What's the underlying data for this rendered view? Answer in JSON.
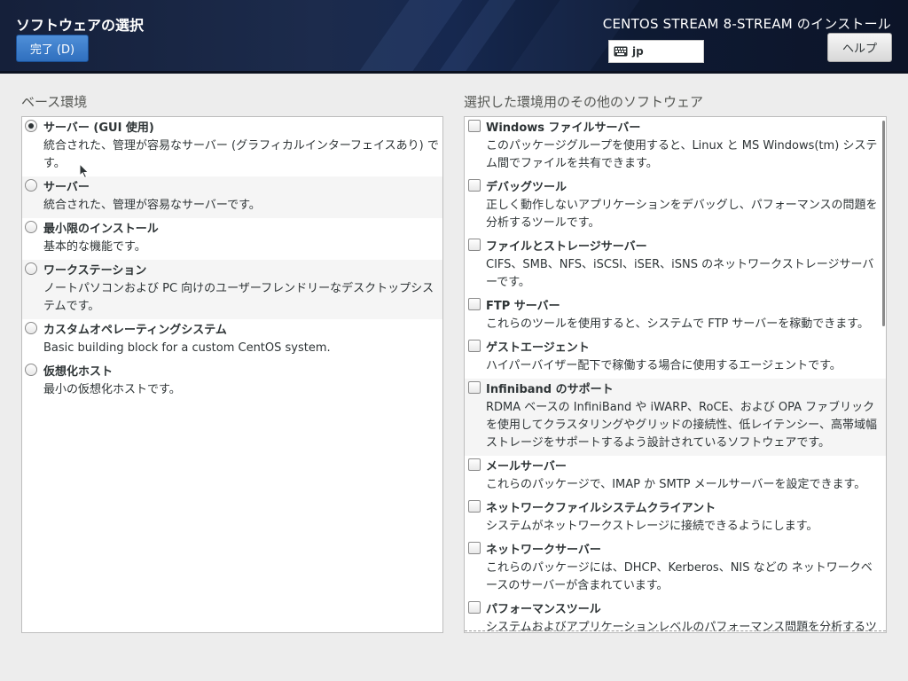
{
  "header": {
    "spoke_title": "ソフトウェアの選択",
    "done_label": "完了 (D)",
    "product_title": "CENTOS STREAM 8-STREAM のインストール",
    "keyboard_layout": "jp",
    "keyboard_icon": "keyboard-icon",
    "help_label": "ヘルプ",
    "accent_color": "#3b7dd0"
  },
  "base_env": {
    "title": "ベース環境",
    "items": [
      {
        "name": "サーバー (GUI 使用)",
        "desc": "統合された、管理が容易なサーバー (グラフィカルインターフェイスあり) です。",
        "selected": true
      },
      {
        "name": "サーバー",
        "desc": "統合された、管理が容易なサーバーです。",
        "selected": false
      },
      {
        "name": "最小限のインストール",
        "desc": "基本的な機能です。",
        "selected": false
      },
      {
        "name": "ワークステーション",
        "desc": "ノートパソコンおよび PC 向けのユーザーフレンドリーなデスクトップシステムです。",
        "selected": false
      },
      {
        "name": "カスタムオペレーティングシステム",
        "desc": "Basic building block for a custom CentOS system.",
        "selected": false
      },
      {
        "name": "仮想化ホスト",
        "desc": "最小の仮想化ホストです。",
        "selected": false
      }
    ]
  },
  "addons": {
    "title": "選択した環境用のその他のソフトウェア",
    "items": [
      {
        "name": "Windows ファイルサーバー",
        "desc": "このパッケージグループを使用すると、Linux と MS Windows(tm) システム間でファイルを共有できます。",
        "checked": false
      },
      {
        "name": "デバッグツール",
        "desc": "正しく動作しないアプリケーションをデバッグし、パフォーマンスの問題を分析するツールです。",
        "checked": false
      },
      {
        "name": "ファイルとストレージサーバー",
        "desc": "CIFS、SMB、NFS、iSCSI、iSER、iSNS のネットワークストレージサーバーです。",
        "checked": false
      },
      {
        "name": "FTP サーバー",
        "desc": "これらのツールを使用すると、システムで FTP サーバーを稼動できます。",
        "checked": false
      },
      {
        "name": "ゲストエージェント",
        "desc": "ハイパーバイザー配下で稼働する場合に使用するエージェントです。",
        "checked": false
      },
      {
        "name": "Infiniband のサポート",
        "desc": "RDMA ベースの InfiniBand や iWARP、RoCE、および OPA ファブリックを使用してクラスタリングやグリッドの接続性、低レイテンシー、高帯域幅ストレージをサポートするよう設計されているソフトウェアです。",
        "checked": false
      },
      {
        "name": "メールサーバー",
        "desc": "これらのパッケージで、IMAP か SMTP メールサーバーを設定できます。",
        "checked": false
      },
      {
        "name": "ネットワークファイルシステムクライアント",
        "desc": "システムがネットワークストレージに接続できるようにします。",
        "checked": false
      },
      {
        "name": "ネットワークサーバー",
        "desc": "これらのパッケージには、DHCP、Kerberos、NIS などの ネットワークベースのサーバーが含まれています。",
        "checked": false
      },
      {
        "name": "パフォーマンスツール",
        "desc": "システムおよびアプリケーションレベルのパフォーマンス問題を分析するツールです。",
        "checked": false
      }
    ]
  }
}
